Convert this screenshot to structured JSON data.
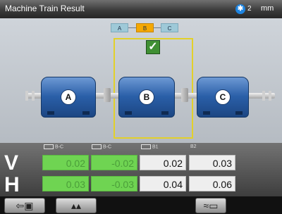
{
  "header": {
    "title": "Machine Train Result",
    "bluetooth_count": "2",
    "units": "mm",
    "bluetooth_icon": "bluetooth-icon"
  },
  "train": {
    "selector_tags": [
      "A",
      "B",
      "C"
    ],
    "machines": [
      {
        "label": "A"
      },
      {
        "label": "B"
      },
      {
        "label": "C"
      }
    ],
    "selected_machine": "B",
    "status_icon": "check-icon"
  },
  "results": {
    "rows": [
      "V",
      "H"
    ],
    "column_headers": [
      "B-C",
      "B-C",
      "B1",
      "B2"
    ],
    "values": {
      "V": [
        "0.02",
        "-0.02",
        "0.02",
        "0.03"
      ],
      "H": [
        "0.03",
        "-0.03",
        "0.04",
        "0.06"
      ]
    }
  },
  "toolbar": {
    "exit_icon": "exit-icon",
    "up_icon": "double-chevron-up-icon",
    "tool_icon": "tool-icon"
  },
  "colors": {
    "accent_yellow": "#e2d02a",
    "machine_blue": "#2a5fa8",
    "good_green": "#6fd452",
    "selected_tag": "#f5a800"
  }
}
